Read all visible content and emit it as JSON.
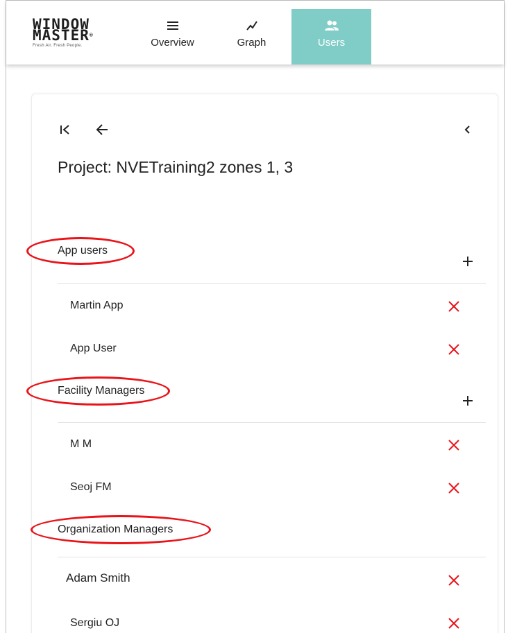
{
  "logo": {
    "word1": "WINDOW",
    "word2": "MASTER",
    "reg": "®",
    "tagline": "Fresh Air. Fresh People."
  },
  "nav": {
    "overview": "Overview",
    "graph": "Graph",
    "users": "Users"
  },
  "project": {
    "title": "Project: NVETraining2 zones 1, 3"
  },
  "sections": {
    "app_users": {
      "label": "App users",
      "users": [
        "Martin App",
        "App User"
      ]
    },
    "facility_managers": {
      "label": "Facility Managers",
      "users": [
        "M M",
        "Seoj FM"
      ]
    },
    "organization_managers": {
      "label": "Organization Managers",
      "users": [
        "Adam Smith",
        "Sergiu OJ"
      ]
    }
  },
  "colors": {
    "accent": "#7fcdc6",
    "delete": "#e8141a",
    "annotation": "#e8141a"
  },
  "icons": {
    "menu": "menu-icon",
    "graph": "trend-icon",
    "users": "people-icon",
    "add": "plus-icon",
    "delete": "close-icon"
  }
}
